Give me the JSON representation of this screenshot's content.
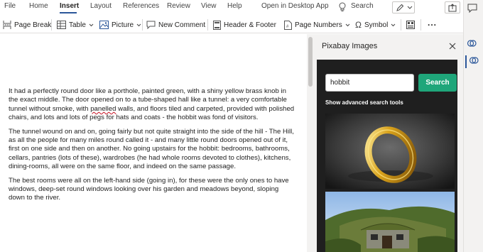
{
  "menu": {
    "tabs": [
      {
        "label": "File"
      },
      {
        "label": "Home"
      },
      {
        "label": "Insert"
      },
      {
        "label": "Layout"
      },
      {
        "label": "References"
      },
      {
        "label": "Review"
      },
      {
        "label": "View"
      },
      {
        "label": "Help"
      },
      {
        "label": "Open in Desktop App"
      }
    ],
    "active_tab": "Insert",
    "search_label": "Search"
  },
  "toolbar": {
    "page_break": "Page Break",
    "table": "Table",
    "picture": "Picture",
    "new_comment": "New Comment",
    "header_footer": "Header & Footer",
    "page_numbers": "Page Numbers",
    "symbol": "Symbol",
    "more": "..."
  },
  "document": {
    "paragraphs": [
      {
        "before": "It had a perfectly round door like a porthole, painted green, with a shiny yellow brass knob in the exact middle. The door opened on to a tube-shaped hall like a tunnel: a very comfortable tunnel without smoke, with ",
        "misspelled": "panelled",
        "after": " walls, and floors tiled and carpeted, provided with polished chairs, and lots and lots of pegs for hats and coats - the hobbit was fond of visitors."
      },
      {
        "text": "The tunnel wound on and on, going fairly but not quite straight into the side of the hill - The Hill, as all the people for many miles round called it - and many little round doors opened out of it, first on one side and then on another. No going upstairs for the hobbit: bedrooms, bathrooms, cellars, pantries (lots of these), wardrobes (he had whole rooms devoted to clothes), kitchens, dining-rooms, all were on the same floor, and indeed on the same passage."
      },
      {
        "text": "The best rooms were all on the left-hand side (going in), for these were the only ones to have windows, deep-set round windows looking over his garden and meadows beyond, sloping down to the river."
      }
    ]
  },
  "pane": {
    "title": "Pixabay Images",
    "search": {
      "value": "hobbit",
      "button": "Search"
    },
    "advanced_link": "Show advanced search tools",
    "results": [
      {
        "subject": "gold ring on dark background"
      },
      {
        "subject": "hobbit house with grassy roof"
      }
    ]
  },
  "colors": {
    "accent": "#2b579a",
    "search_button": "#1fa67a",
    "pane_dark": "#1f1f1f",
    "misspelling": "#c50f1f"
  },
  "icons": [
    "page-break-icon",
    "table-icon",
    "picture-icon",
    "comment-icon",
    "header-footer-icon",
    "page-numbers-icon",
    "omega-icon",
    "more-icon",
    "lightbulb-icon",
    "pen-icon",
    "share-icon",
    "comment-bubble-icon",
    "close-icon"
  ]
}
